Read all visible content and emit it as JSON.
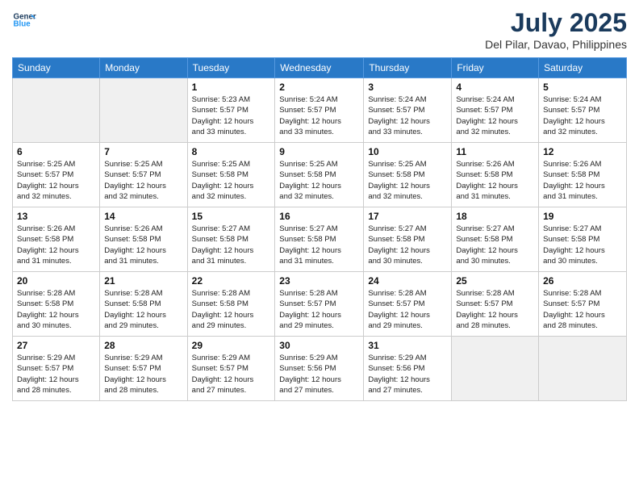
{
  "logo": {
    "line1": "General",
    "line2": "Blue"
  },
  "title": "July 2025",
  "location": "Del Pilar, Davao, Philippines",
  "weekdays": [
    "Sunday",
    "Monday",
    "Tuesday",
    "Wednesday",
    "Thursday",
    "Friday",
    "Saturday"
  ],
  "weeks": [
    [
      {
        "day": "",
        "info": ""
      },
      {
        "day": "",
        "info": ""
      },
      {
        "day": "1",
        "info": "Sunrise: 5:23 AM\nSunset: 5:57 PM\nDaylight: 12 hours\nand 33 minutes."
      },
      {
        "day": "2",
        "info": "Sunrise: 5:24 AM\nSunset: 5:57 PM\nDaylight: 12 hours\nand 33 minutes."
      },
      {
        "day": "3",
        "info": "Sunrise: 5:24 AM\nSunset: 5:57 PM\nDaylight: 12 hours\nand 33 minutes."
      },
      {
        "day": "4",
        "info": "Sunrise: 5:24 AM\nSunset: 5:57 PM\nDaylight: 12 hours\nand 32 minutes."
      },
      {
        "day": "5",
        "info": "Sunrise: 5:24 AM\nSunset: 5:57 PM\nDaylight: 12 hours\nand 32 minutes."
      }
    ],
    [
      {
        "day": "6",
        "info": "Sunrise: 5:25 AM\nSunset: 5:57 PM\nDaylight: 12 hours\nand 32 minutes."
      },
      {
        "day": "7",
        "info": "Sunrise: 5:25 AM\nSunset: 5:57 PM\nDaylight: 12 hours\nand 32 minutes."
      },
      {
        "day": "8",
        "info": "Sunrise: 5:25 AM\nSunset: 5:58 PM\nDaylight: 12 hours\nand 32 minutes."
      },
      {
        "day": "9",
        "info": "Sunrise: 5:25 AM\nSunset: 5:58 PM\nDaylight: 12 hours\nand 32 minutes."
      },
      {
        "day": "10",
        "info": "Sunrise: 5:25 AM\nSunset: 5:58 PM\nDaylight: 12 hours\nand 32 minutes."
      },
      {
        "day": "11",
        "info": "Sunrise: 5:26 AM\nSunset: 5:58 PM\nDaylight: 12 hours\nand 31 minutes."
      },
      {
        "day": "12",
        "info": "Sunrise: 5:26 AM\nSunset: 5:58 PM\nDaylight: 12 hours\nand 31 minutes."
      }
    ],
    [
      {
        "day": "13",
        "info": "Sunrise: 5:26 AM\nSunset: 5:58 PM\nDaylight: 12 hours\nand 31 minutes."
      },
      {
        "day": "14",
        "info": "Sunrise: 5:26 AM\nSunset: 5:58 PM\nDaylight: 12 hours\nand 31 minutes."
      },
      {
        "day": "15",
        "info": "Sunrise: 5:27 AM\nSunset: 5:58 PM\nDaylight: 12 hours\nand 31 minutes."
      },
      {
        "day": "16",
        "info": "Sunrise: 5:27 AM\nSunset: 5:58 PM\nDaylight: 12 hours\nand 31 minutes."
      },
      {
        "day": "17",
        "info": "Sunrise: 5:27 AM\nSunset: 5:58 PM\nDaylight: 12 hours\nand 30 minutes."
      },
      {
        "day": "18",
        "info": "Sunrise: 5:27 AM\nSunset: 5:58 PM\nDaylight: 12 hours\nand 30 minutes."
      },
      {
        "day": "19",
        "info": "Sunrise: 5:27 AM\nSunset: 5:58 PM\nDaylight: 12 hours\nand 30 minutes."
      }
    ],
    [
      {
        "day": "20",
        "info": "Sunrise: 5:28 AM\nSunset: 5:58 PM\nDaylight: 12 hours\nand 30 minutes."
      },
      {
        "day": "21",
        "info": "Sunrise: 5:28 AM\nSunset: 5:58 PM\nDaylight: 12 hours\nand 29 minutes."
      },
      {
        "day": "22",
        "info": "Sunrise: 5:28 AM\nSunset: 5:58 PM\nDaylight: 12 hours\nand 29 minutes."
      },
      {
        "day": "23",
        "info": "Sunrise: 5:28 AM\nSunset: 5:57 PM\nDaylight: 12 hours\nand 29 minutes."
      },
      {
        "day": "24",
        "info": "Sunrise: 5:28 AM\nSunset: 5:57 PM\nDaylight: 12 hours\nand 29 minutes."
      },
      {
        "day": "25",
        "info": "Sunrise: 5:28 AM\nSunset: 5:57 PM\nDaylight: 12 hours\nand 28 minutes."
      },
      {
        "day": "26",
        "info": "Sunrise: 5:28 AM\nSunset: 5:57 PM\nDaylight: 12 hours\nand 28 minutes."
      }
    ],
    [
      {
        "day": "27",
        "info": "Sunrise: 5:29 AM\nSunset: 5:57 PM\nDaylight: 12 hours\nand 28 minutes."
      },
      {
        "day": "28",
        "info": "Sunrise: 5:29 AM\nSunset: 5:57 PM\nDaylight: 12 hours\nand 28 minutes."
      },
      {
        "day": "29",
        "info": "Sunrise: 5:29 AM\nSunset: 5:57 PM\nDaylight: 12 hours\nand 27 minutes."
      },
      {
        "day": "30",
        "info": "Sunrise: 5:29 AM\nSunset: 5:56 PM\nDaylight: 12 hours\nand 27 minutes."
      },
      {
        "day": "31",
        "info": "Sunrise: 5:29 AM\nSunset: 5:56 PM\nDaylight: 12 hours\nand 27 minutes."
      },
      {
        "day": "",
        "info": ""
      },
      {
        "day": "",
        "info": ""
      }
    ]
  ]
}
